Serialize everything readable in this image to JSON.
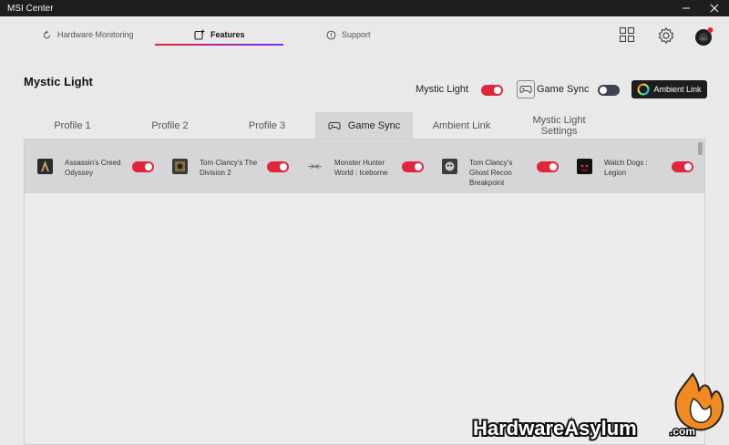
{
  "window": {
    "title": "MSI Center"
  },
  "nav": {
    "items": [
      {
        "label": "Hardware Monitoring",
        "icon": "refresh-icon"
      },
      {
        "label": "Features",
        "icon": "plus-square-icon"
      },
      {
        "label": "Support",
        "icon": "info-icon"
      }
    ],
    "active": "Features"
  },
  "page": {
    "title": "Mystic Light"
  },
  "header_toggles": {
    "mystic_light_label": "Mystic Light",
    "game_sync_label": "Game Sync",
    "ambient_link_label": "Ambient Link"
  },
  "tabs": [
    "Profile 1",
    "Profile 2",
    "Profile 3",
    "Game Sync",
    "Ambient Link",
    "Mystic Light Settings"
  ],
  "active_tab": "Game Sync",
  "games": [
    {
      "name": "Assassin's Creed Odyssey",
      "enabled": true
    },
    {
      "name": "Tom Clancy's The Division 2",
      "enabled": true
    },
    {
      "name": "Monster Hunter World : Iceborne",
      "enabled": true
    },
    {
      "name": "Tom Clancy's Ghost Recon Breakpoint",
      "enabled": true
    },
    {
      "name": "Watch Dogs : Legion",
      "enabled": true
    }
  ],
  "watermark": {
    "text": "HardwareAsylum",
    "suffix": ".com"
  },
  "colors": {
    "accent": "#e0263b",
    "toggle_off": "#3d4250",
    "titlebar": "#1e1e1e"
  }
}
